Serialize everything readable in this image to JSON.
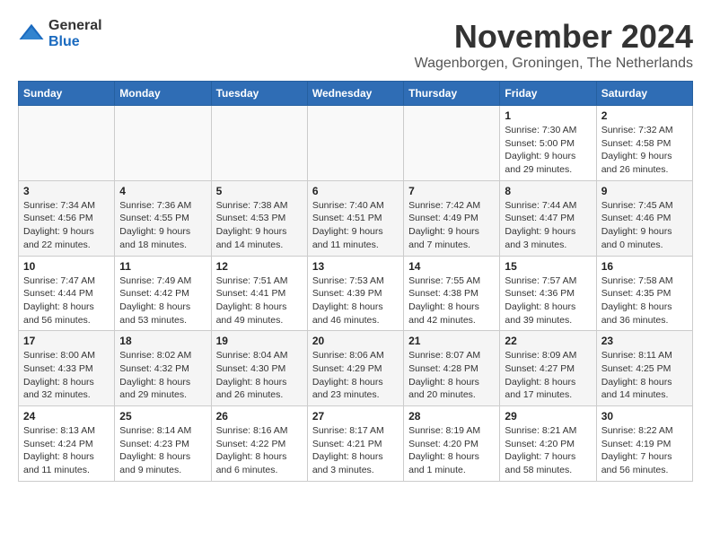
{
  "header": {
    "logo": {
      "general": "General",
      "blue": "Blue"
    },
    "title": "November 2024",
    "subtitle": "Wagenborgen, Groningen, The Netherlands"
  },
  "weekdays": [
    "Sunday",
    "Monday",
    "Tuesday",
    "Wednesday",
    "Thursday",
    "Friday",
    "Saturday"
  ],
  "weeks": [
    [
      {
        "day": "",
        "info": ""
      },
      {
        "day": "",
        "info": ""
      },
      {
        "day": "",
        "info": ""
      },
      {
        "day": "",
        "info": ""
      },
      {
        "day": "",
        "info": ""
      },
      {
        "day": "1",
        "info": "Sunrise: 7:30 AM\nSunset: 5:00 PM\nDaylight: 9 hours and 29 minutes."
      },
      {
        "day": "2",
        "info": "Sunrise: 7:32 AM\nSunset: 4:58 PM\nDaylight: 9 hours and 26 minutes."
      }
    ],
    [
      {
        "day": "3",
        "info": "Sunrise: 7:34 AM\nSunset: 4:56 PM\nDaylight: 9 hours and 22 minutes."
      },
      {
        "day": "4",
        "info": "Sunrise: 7:36 AM\nSunset: 4:55 PM\nDaylight: 9 hours and 18 minutes."
      },
      {
        "day": "5",
        "info": "Sunrise: 7:38 AM\nSunset: 4:53 PM\nDaylight: 9 hours and 14 minutes."
      },
      {
        "day": "6",
        "info": "Sunrise: 7:40 AM\nSunset: 4:51 PM\nDaylight: 9 hours and 11 minutes."
      },
      {
        "day": "7",
        "info": "Sunrise: 7:42 AM\nSunset: 4:49 PM\nDaylight: 9 hours and 7 minutes."
      },
      {
        "day": "8",
        "info": "Sunrise: 7:44 AM\nSunset: 4:47 PM\nDaylight: 9 hours and 3 minutes."
      },
      {
        "day": "9",
        "info": "Sunrise: 7:45 AM\nSunset: 4:46 PM\nDaylight: 9 hours and 0 minutes."
      }
    ],
    [
      {
        "day": "10",
        "info": "Sunrise: 7:47 AM\nSunset: 4:44 PM\nDaylight: 8 hours and 56 minutes."
      },
      {
        "day": "11",
        "info": "Sunrise: 7:49 AM\nSunset: 4:42 PM\nDaylight: 8 hours and 53 minutes."
      },
      {
        "day": "12",
        "info": "Sunrise: 7:51 AM\nSunset: 4:41 PM\nDaylight: 8 hours and 49 minutes."
      },
      {
        "day": "13",
        "info": "Sunrise: 7:53 AM\nSunset: 4:39 PM\nDaylight: 8 hours and 46 minutes."
      },
      {
        "day": "14",
        "info": "Sunrise: 7:55 AM\nSunset: 4:38 PM\nDaylight: 8 hours and 42 minutes."
      },
      {
        "day": "15",
        "info": "Sunrise: 7:57 AM\nSunset: 4:36 PM\nDaylight: 8 hours and 39 minutes."
      },
      {
        "day": "16",
        "info": "Sunrise: 7:58 AM\nSunset: 4:35 PM\nDaylight: 8 hours and 36 minutes."
      }
    ],
    [
      {
        "day": "17",
        "info": "Sunrise: 8:00 AM\nSunset: 4:33 PM\nDaylight: 8 hours and 32 minutes."
      },
      {
        "day": "18",
        "info": "Sunrise: 8:02 AM\nSunset: 4:32 PM\nDaylight: 8 hours and 29 minutes."
      },
      {
        "day": "19",
        "info": "Sunrise: 8:04 AM\nSunset: 4:30 PM\nDaylight: 8 hours and 26 minutes."
      },
      {
        "day": "20",
        "info": "Sunrise: 8:06 AM\nSunset: 4:29 PM\nDaylight: 8 hours and 23 minutes."
      },
      {
        "day": "21",
        "info": "Sunrise: 8:07 AM\nSunset: 4:28 PM\nDaylight: 8 hours and 20 minutes."
      },
      {
        "day": "22",
        "info": "Sunrise: 8:09 AM\nSunset: 4:27 PM\nDaylight: 8 hours and 17 minutes."
      },
      {
        "day": "23",
        "info": "Sunrise: 8:11 AM\nSunset: 4:25 PM\nDaylight: 8 hours and 14 minutes."
      }
    ],
    [
      {
        "day": "24",
        "info": "Sunrise: 8:13 AM\nSunset: 4:24 PM\nDaylight: 8 hours and 11 minutes."
      },
      {
        "day": "25",
        "info": "Sunrise: 8:14 AM\nSunset: 4:23 PM\nDaylight: 8 hours and 9 minutes."
      },
      {
        "day": "26",
        "info": "Sunrise: 8:16 AM\nSunset: 4:22 PM\nDaylight: 8 hours and 6 minutes."
      },
      {
        "day": "27",
        "info": "Sunrise: 8:17 AM\nSunset: 4:21 PM\nDaylight: 8 hours and 3 minutes."
      },
      {
        "day": "28",
        "info": "Sunrise: 8:19 AM\nSunset: 4:20 PM\nDaylight: 8 hours and 1 minute."
      },
      {
        "day": "29",
        "info": "Sunrise: 8:21 AM\nSunset: 4:20 PM\nDaylight: 7 hours and 58 minutes."
      },
      {
        "day": "30",
        "info": "Sunrise: 8:22 AM\nSunset: 4:19 PM\nDaylight: 7 hours and 56 minutes."
      }
    ]
  ]
}
